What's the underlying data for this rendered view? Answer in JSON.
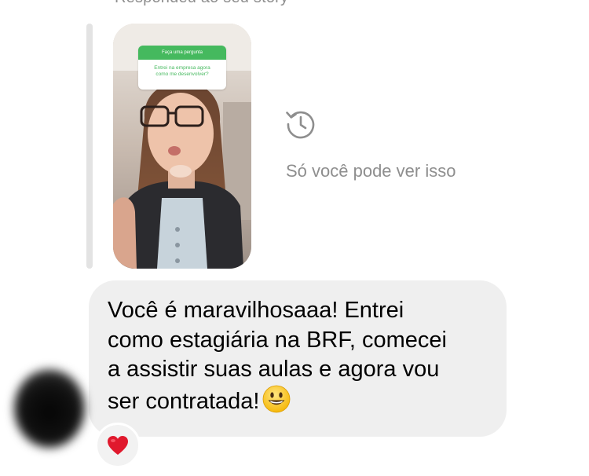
{
  "thread": {
    "reply_caption": "Respondeu ao seu story"
  },
  "story": {
    "question_header": "Faça uma pergunta",
    "question_text": "Entrei na empresa agora\ncomo me desenvolver?",
    "privacy_icon": "history-icon",
    "privacy_note": "Só você pode ver isso"
  },
  "message": {
    "text": "Você é maravilhosaaa! Entrei\ncomo estagiária na BRF, comecei\na assistir suas aulas e agora vou\nser contratada!",
    "emoji": "grinning-face-emoji",
    "reaction": "heart-reaction-icon"
  },
  "colors": {
    "bubble": "#efefef",
    "muted_text": "#8e8e8e",
    "question_green": "#45b95e",
    "heart_red": "#e0192d"
  }
}
